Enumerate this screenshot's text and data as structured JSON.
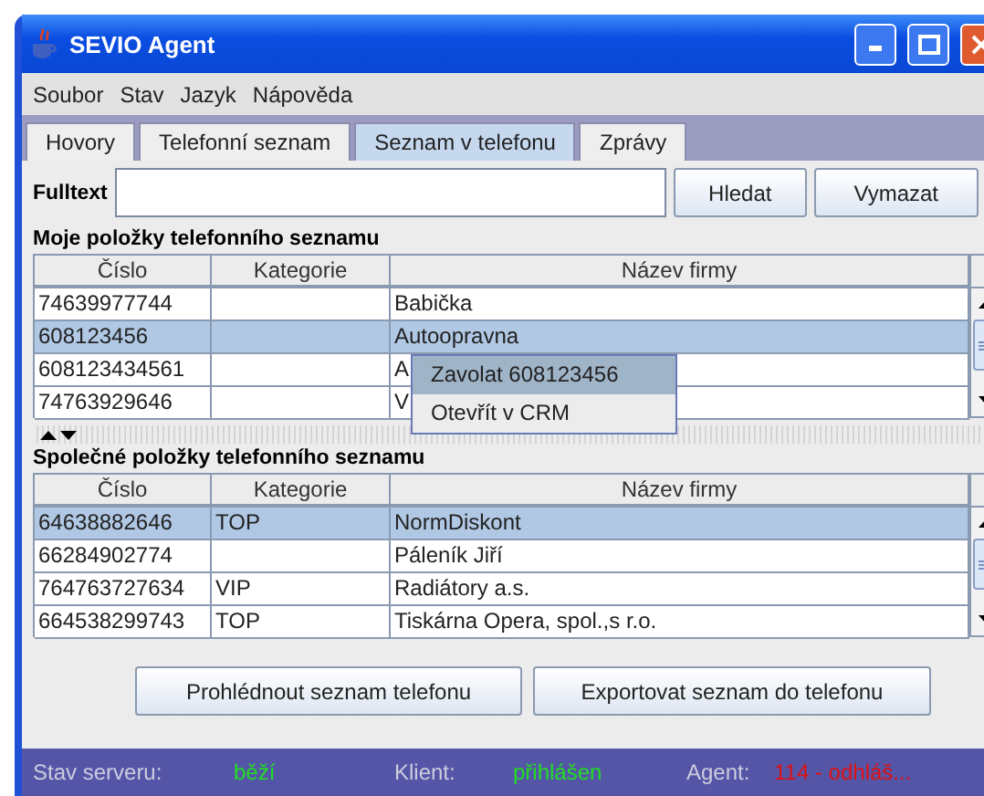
{
  "window": {
    "title": "SEVIO Agent"
  },
  "menu": [
    "Soubor",
    "Stav",
    "Jazyk",
    "Nápověda"
  ],
  "tabs": [
    {
      "label": "Hovory",
      "selected": false
    },
    {
      "label": "Telefonní seznam",
      "selected": false
    },
    {
      "label": "Seznam v telefonu",
      "selected": true
    },
    {
      "label": "Zprávy",
      "selected": false
    }
  ],
  "search": {
    "label": "Fulltext",
    "buttons": [
      "Hledat",
      "Vymazat"
    ]
  },
  "sections": [
    {
      "title": "Moje položky telefonního seznamu",
      "columns": [
        "Číslo",
        "Kategorie",
        "Název firmy"
      ],
      "rows": [
        {
          "number": "74639977744",
          "name": "Babička",
          "selected": false
        },
        {
          "number": "608123456",
          "name": "Autoopravna",
          "selected": true
        },
        {
          "number": "608123434561",
          "name": "A",
          "selected": false
        },
        {
          "number": "74763929646",
          "name": "V",
          "selected": false
        }
      ]
    },
    {
      "title": "Společné položky telefonního seznamu",
      "columns": [
        "Číslo",
        "Kategorie",
        "Název firmy"
      ],
      "rows": [
        {
          "number": "64638882646",
          "category": "TOP",
          "name": "NormDiskont",
          "selected": true
        },
        {
          "number": "66284902774",
          "name": "Páleník Jiří",
          "selected": false
        },
        {
          "number": "764763727634",
          "category": "VIP",
          "name": "Radiátory a.s.",
          "selected": false
        },
        {
          "number": "664538299743",
          "category": "TOP",
          "name": "Tiskárna Opera, spol.,s r.o.",
          "selected": false
        }
      ]
    }
  ],
  "context_menu": [
    {
      "label": "Zavolat 608123456",
      "selected": true
    },
    {
      "label": "Otevřít v CRM",
      "selected": false
    }
  ],
  "actions": [
    "Prohlédnout seznam telefonu",
    "Exportovat seznam do telefonu"
  ],
  "status_bar": [
    {
      "label": "Stav serveru:",
      "value": "běží",
      "color": "#22dd22"
    },
    {
      "label": "Klient:",
      "value": "přihlášen",
      "color": "#22dd22"
    },
    {
      "label": "Agent:",
      "value": "114 - odhláš...",
      "color": "#dd1111"
    }
  ]
}
